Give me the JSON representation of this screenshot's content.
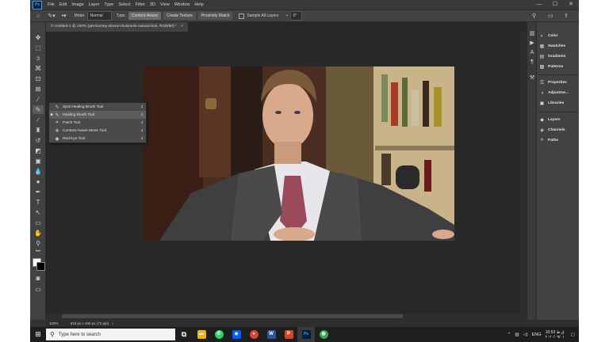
{
  "menubar": {
    "logo": "Ps",
    "items": [
      "File",
      "Edit",
      "Image",
      "Layer",
      "Type",
      "Select",
      "Filter",
      "3D",
      "View",
      "Window",
      "Help"
    ],
    "controls": {
      "minimize": "—",
      "maximize": "☐",
      "close": "✕"
    }
  },
  "options": {
    "mode_label": "Mode:",
    "mode_value": "Normal",
    "type_label": "Type:",
    "type_buttons": [
      "Content-Aware",
      "Create Texture",
      "Proximity Match"
    ],
    "sample_all_layers": "Sample All Layers",
    "angle_value": "0°"
  },
  "document": {
    "tab_title": "© Untitled-1 @ 100% (get-barney-stinson-business-casual-look, RGB/8#) *",
    "tab_close": "×"
  },
  "flyout": {
    "items": [
      {
        "label": "Spot Healing Brush Tool",
        "key": "J",
        "icon": "✎",
        "selected": false
      },
      {
        "label": "Healing Brush Tool",
        "key": "J",
        "icon": "✎",
        "selected": true
      },
      {
        "label": "Patch Tool",
        "key": "J",
        "icon": "⌗",
        "selected": false
      },
      {
        "label": "Content-Aware Move Tool",
        "key": "J",
        "icon": "✜",
        "selected": false
      },
      {
        "label": "Red Eye Tool",
        "key": "J",
        "icon": "◉",
        "selected": false
      }
    ],
    "selected_mark": "■"
  },
  "panels": {
    "items": [
      {
        "label": "Color",
        "icon": "◐"
      },
      {
        "label": "Swatches",
        "icon": "▦"
      },
      {
        "label": "Gradients",
        "icon": "▤"
      },
      {
        "label": "Patterns",
        "icon": "▩"
      },
      {
        "label": "Properties",
        "icon": "☰"
      },
      {
        "label": "Adjustme...",
        "icon": "◑"
      },
      {
        "label": "Libraries",
        "icon": "▣"
      },
      {
        "label": "Layers",
        "icon": "◆"
      },
      {
        "label": "Channels",
        "icon": "◈"
      },
      {
        "label": "Paths",
        "icon": "⟡"
      }
    ]
  },
  "status": {
    "zoom": "100%",
    "doc_size": "818 px x 460 px (72 ppi)"
  },
  "taskbar": {
    "search_placeholder": "Type here to search",
    "apps": [
      {
        "name": "task-view",
        "glyph": "⧉",
        "color": "#1e1e1e"
      },
      {
        "name": "file-explorer",
        "glyph": "▬",
        "color": "#f2b01e"
      },
      {
        "name": "whatsapp",
        "glyph": "✆",
        "color": "#25d366"
      },
      {
        "name": "dropbox",
        "glyph": "◆",
        "color": "#0061fe"
      },
      {
        "name": "chrome",
        "glyph": "●",
        "color": "#db4437"
      },
      {
        "name": "word",
        "glyph": "W",
        "color": "#2b579a"
      },
      {
        "name": "powerpoint",
        "glyph": "P",
        "color": "#d24726"
      },
      {
        "name": "photoshop",
        "glyph": "Ps",
        "color": "#001e36"
      },
      {
        "name": "browser",
        "glyph": "◍",
        "color": "#3aa757"
      }
    ],
    "language": "ENG",
    "time": "10:53 ق.ظ",
    "date": "۲۰۲۰/۰۹/۰۱"
  }
}
